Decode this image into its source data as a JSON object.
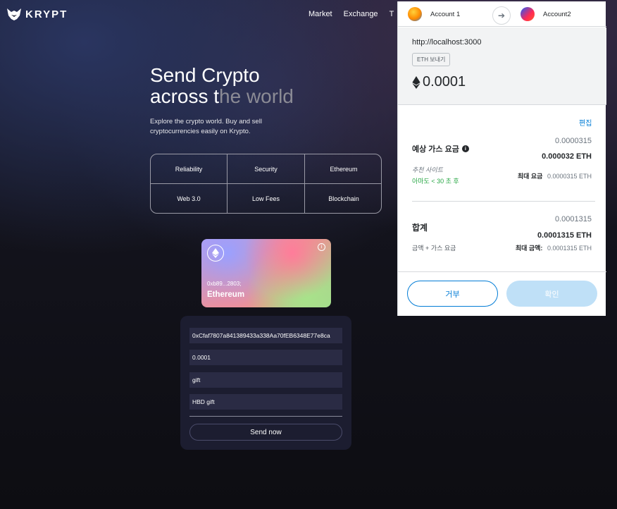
{
  "brand": {
    "name": "KRYPT"
  },
  "nav": {
    "items": [
      "Market",
      "Exchange",
      "T"
    ]
  },
  "hero": {
    "title_line1": "Send Crypto",
    "title_line2a": "across t",
    "title_line2b": "he world",
    "subtitle": "Explore the crypto world. Buy and sell cryptocurrencies easily on Krypto."
  },
  "features": [
    "Reliability",
    "Security",
    "Ethereum",
    "Web 3.0",
    "Low Fees",
    "Blockchain"
  ],
  "eth_card": {
    "address": "0xb89...2803;",
    "name": "Ethereum"
  },
  "form": {
    "address": "0xCfaf7807a841389433a338Aa70fEB6348E77e8ca",
    "amount": "0.0001",
    "keyword": "gift",
    "message": "HBD gift",
    "send_label": "Send now"
  },
  "metamask": {
    "from_account": "Account 1",
    "to_account": "Account2",
    "origin": "http://localhost:3000",
    "tx_type": "ETH 보내기",
    "amount": "0.0001",
    "edit_label": "편집",
    "gas_label": "예상 가스 요금",
    "gas_value_small": "0.0000315",
    "gas_value_eth": "0.000032 ETH",
    "suggested_site": "추천 사이트",
    "time_estimate": "아마도 < 30 초 후",
    "max_fee_label": "최대 요금",
    "max_fee_value": "0.0000315 ETH",
    "total_label": "합계",
    "total_value_small": "0.0001315",
    "total_value_eth": "0.0001315 ETH",
    "total_sub_label": "금액 + 가스 요금",
    "max_amount_label": "최대 금액:",
    "max_amount_value": "0.0001315 ETH",
    "reject_label": "거부",
    "confirm_label": "확인"
  },
  "colors": {
    "accent": "#037dd6",
    "green": "#28a745",
    "confirm_disabled": "#bfe0f7"
  }
}
